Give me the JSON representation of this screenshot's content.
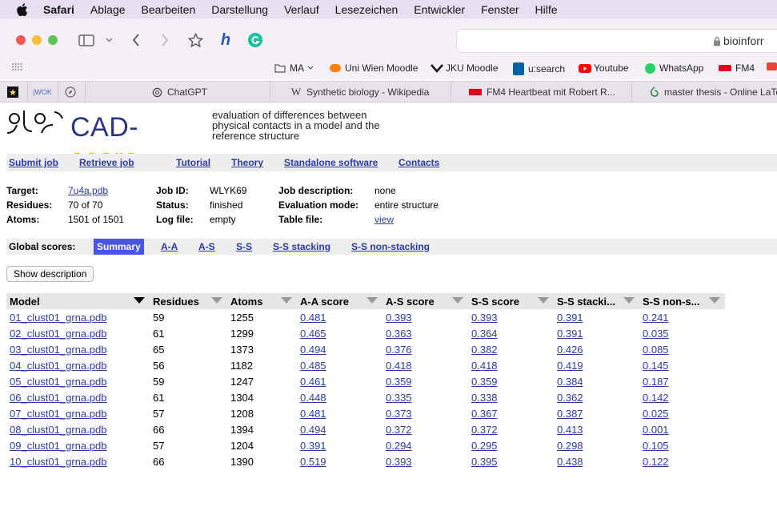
{
  "menubar": {
    "app": "Safari",
    "items": [
      "Ablage",
      "Bearbeiten",
      "Darstellung",
      "Verlauf",
      "Lesezeichen",
      "Entwickler",
      "Fenster",
      "Hilfe"
    ]
  },
  "toolbar": {
    "url": "bioinforr"
  },
  "bookmarks": [
    {
      "label": "MA",
      "icon": "folder-icon"
    },
    {
      "label": "Uni Wien Moodle",
      "icon": "moodle-icon"
    },
    {
      "label": "JKU Moodle",
      "icon": "jku-icon"
    },
    {
      "label": "u:search",
      "icon": "univie-icon"
    },
    {
      "label": "Youtube",
      "icon": "youtube-icon"
    },
    {
      "label": "WhatsApp",
      "icon": "whatsapp-icon"
    },
    {
      "label": "FM4",
      "icon": "orf-icon"
    }
  ],
  "tabs": [
    {
      "label": "ChatGPT"
    },
    {
      "label": "Synthetic biology - Wikipedia"
    },
    {
      "label": "FM4 Heartbeat mit Robert R..."
    },
    {
      "label": "master thesis - Online LaTe"
    }
  ],
  "page": {
    "logo_text": "CAD-score",
    "tagline": "evaluation of differences between physical contacts in a model and the reference structure",
    "nav": [
      "Submit job",
      "Retrieve job",
      "Tutorial",
      "Theory",
      "Standalone software",
      "Contacts"
    ],
    "info": {
      "target_label": "Target:",
      "target_value": "7u4a.pdb",
      "residues_label": "Residues:",
      "residues_value": "70 of 70",
      "atoms_label": "Atoms:",
      "atoms_value": "1501 of 1501",
      "jobid_label": "Job ID:",
      "jobid_value": "WLYK69",
      "status_label": "Status:",
      "status_value": "finished",
      "logfile_label": "Log file:",
      "logfile_value": "empty",
      "jobdesc_label": "Job description:",
      "jobdesc_value": "none",
      "evalmode_label": "Evaluation mode:",
      "evalmode_value": "entire structure",
      "tablefile_label": "Table file:",
      "tablefile_value": "view"
    },
    "global_scores_label": "Global scores:",
    "score_tabs": [
      "Summary",
      "A-A",
      "A-S",
      "S-S",
      "S-S stacking",
      "S-S non-stacking"
    ],
    "show_description": "Show description",
    "table": {
      "headers": [
        "Model",
        "Residues",
        "Atoms",
        "A-A score",
        "A-S score",
        "S-S score",
        "S-S stacki...",
        "S-S non-s..."
      ],
      "rows": [
        [
          "01_clust01_grna.pdb",
          "59",
          "1255",
          "0.481",
          "0.393",
          "0.393",
          "0.391",
          "0.241"
        ],
        [
          "02_clust01_grna.pdb",
          "61",
          "1299",
          "0.465",
          "0.363",
          "0.364",
          "0.391",
          "0.035"
        ],
        [
          "03_clust01_grna.pdb",
          "65",
          "1373",
          "0.494",
          "0.376",
          "0.382",
          "0.426",
          "0.085"
        ],
        [
          "04_clust01_grna.pdb",
          "56",
          "1182",
          "0.485",
          "0.418",
          "0.418",
          "0.419",
          "0.145"
        ],
        [
          "05_clust01_grna.pdb",
          "59",
          "1247",
          "0.461",
          "0.359",
          "0.359",
          "0.384",
          "0.187"
        ],
        [
          "06_clust01_grna.pdb",
          "61",
          "1304",
          "0.448",
          "0.335",
          "0.338",
          "0.362",
          "0.142"
        ],
        [
          "07_clust01_grna.pdb",
          "57",
          "1208",
          "0.481",
          "0.373",
          "0.367",
          "0.387",
          "0.025"
        ],
        [
          "08_clust01_grna.pdb",
          "66",
          "1394",
          "0.494",
          "0.372",
          "0.372",
          "0.413",
          "0.001"
        ],
        [
          "09_clust01_grna.pdb",
          "57",
          "1204",
          "0.391",
          "0.294",
          "0.295",
          "0.298",
          "0.105"
        ],
        [
          "10_clust01_grna.pdb",
          "66",
          "1390",
          "0.519",
          "0.393",
          "0.395",
          "0.438",
          "0.122"
        ]
      ]
    }
  },
  "colors": {
    "link": "#2b3aa8",
    "active_tab": "#4a52ee",
    "menubar_bg": "#e6dff0",
    "logo_blue": "#2a3680",
    "logo_yellow": "#f2c200"
  }
}
